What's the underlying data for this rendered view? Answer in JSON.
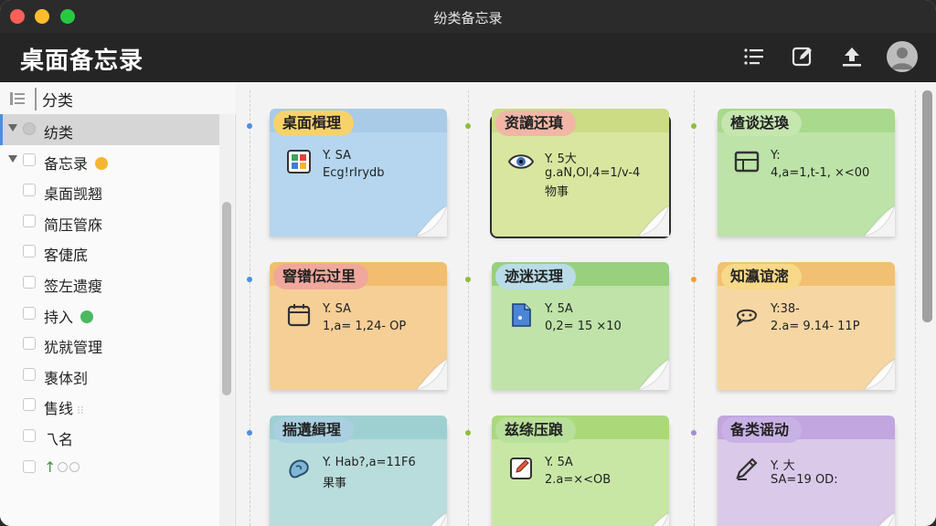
{
  "window": {
    "title": "纷类备忘录"
  },
  "toolbar": {
    "app_title": "桌面备忘录",
    "icons": [
      "list-icon",
      "edit-icon",
      "export-icon",
      "avatar-icon"
    ]
  },
  "sidebar": {
    "header": "分类",
    "items": [
      {
        "label": "纺类",
        "active": true,
        "caret": true,
        "checkbox": "round"
      },
      {
        "label": "备忘录",
        "caret": true,
        "dot_color": "#f5b731"
      },
      {
        "label": "桌面觊翘"
      },
      {
        "label": "简压管庥"
      },
      {
        "label": "客倢底"
      },
      {
        "label": "签左遗瘦"
      },
      {
        "label": "持入",
        "dot_color": "#4cb860"
      },
      {
        "label": "犹就管理"
      },
      {
        "label": "褢体刭"
      },
      {
        "label": "售线",
        "suffix": "⁝⁝"
      },
      {
        "label": "乁名"
      },
      {
        "label": "↑",
        "label_color": "#3a9b3a",
        "rings": 2
      }
    ]
  },
  "colors": {
    "accent": "#4a8fe0",
    "blue_dot": "#4a8fe0",
    "green_dot": "#8bbf3a",
    "orange_dot": "#f0a030",
    "purple_dot": "#a78bd0"
  },
  "notes": [
    {
      "title": "桌面楫理",
      "lines": [
        "Y. SA",
        "Ecg!rIrydb"
      ],
      "icon": "calendar-grid-icon",
      "color": "#b5d6ee",
      "strip": "#a9cbe7",
      "tag": "#f7d26b"
    },
    {
      "title": "资讁还瑱",
      "lines": [
        "Y. 5大",
        "g.aN,Ol,4=1/v-4",
        "物事"
      ],
      "icon": "eye-icon",
      "color": "#d8e6a0",
      "strip": "#cbdc84",
      "tag": "#f1b6a6",
      "selected": true
    },
    {
      "title": "楂谈送瑍",
      "lines": [
        "Y:",
        "4,a=1,t-1,  ×<00"
      ],
      "icon": "panel-icon",
      "color": "#bde3a8",
      "strip": "#a8d98c",
      "tag": "#c6e6b0"
    },
    {
      "title": "窨镨伝过里",
      "lines": [
        "Y. SA",
        "1,a= 1,24- OP"
      ],
      "icon": "calendar-icon",
      "color": "#f6cf97",
      "strip": "#f2bd6f",
      "tag": "#f0a79c"
    },
    {
      "title": "迹迷迗理",
      "lines": [
        "Y. 5A",
        "0,2= 15 ×10"
      ],
      "icon": "document-icon",
      "color": "#bfe3a8",
      "strip": "#98d07e",
      "tag": "#b9dce7"
    },
    {
      "title": "知瀛谊滵",
      "lines": [
        "Y:38-",
        "2.a= 9.14- 11P"
      ],
      "icon": "chat-icon",
      "color": "#f6d7a3",
      "strip": "#f2c072",
      "tag": "#f8d889"
    },
    {
      "title": "揣遘緝瑆",
      "lines": [
        "Y. Hab?,a=11F6",
        "果事"
      ],
      "icon": "brain-icon",
      "color": "#b9dddd",
      "strip": "#9ed0d2",
      "tag": "#a9cfe0"
    },
    {
      "title": "兹绦压踉",
      "lines": [
        "Y. 5A",
        "2.a=×<OB"
      ],
      "icon": "note-pencil-icon",
      "color": "#c8e7a5",
      "strip": "#abd97a",
      "tag": "#b9e09a"
    },
    {
      "title": "备类谣动",
      "lines": [
        "Y. 大",
        "SA=19 OD:"
      ],
      "icon": "pencil-icon",
      "color": "#dbc9ea",
      "strip": "#c2a6df",
      "tag": "#c8b1e4"
    }
  ]
}
